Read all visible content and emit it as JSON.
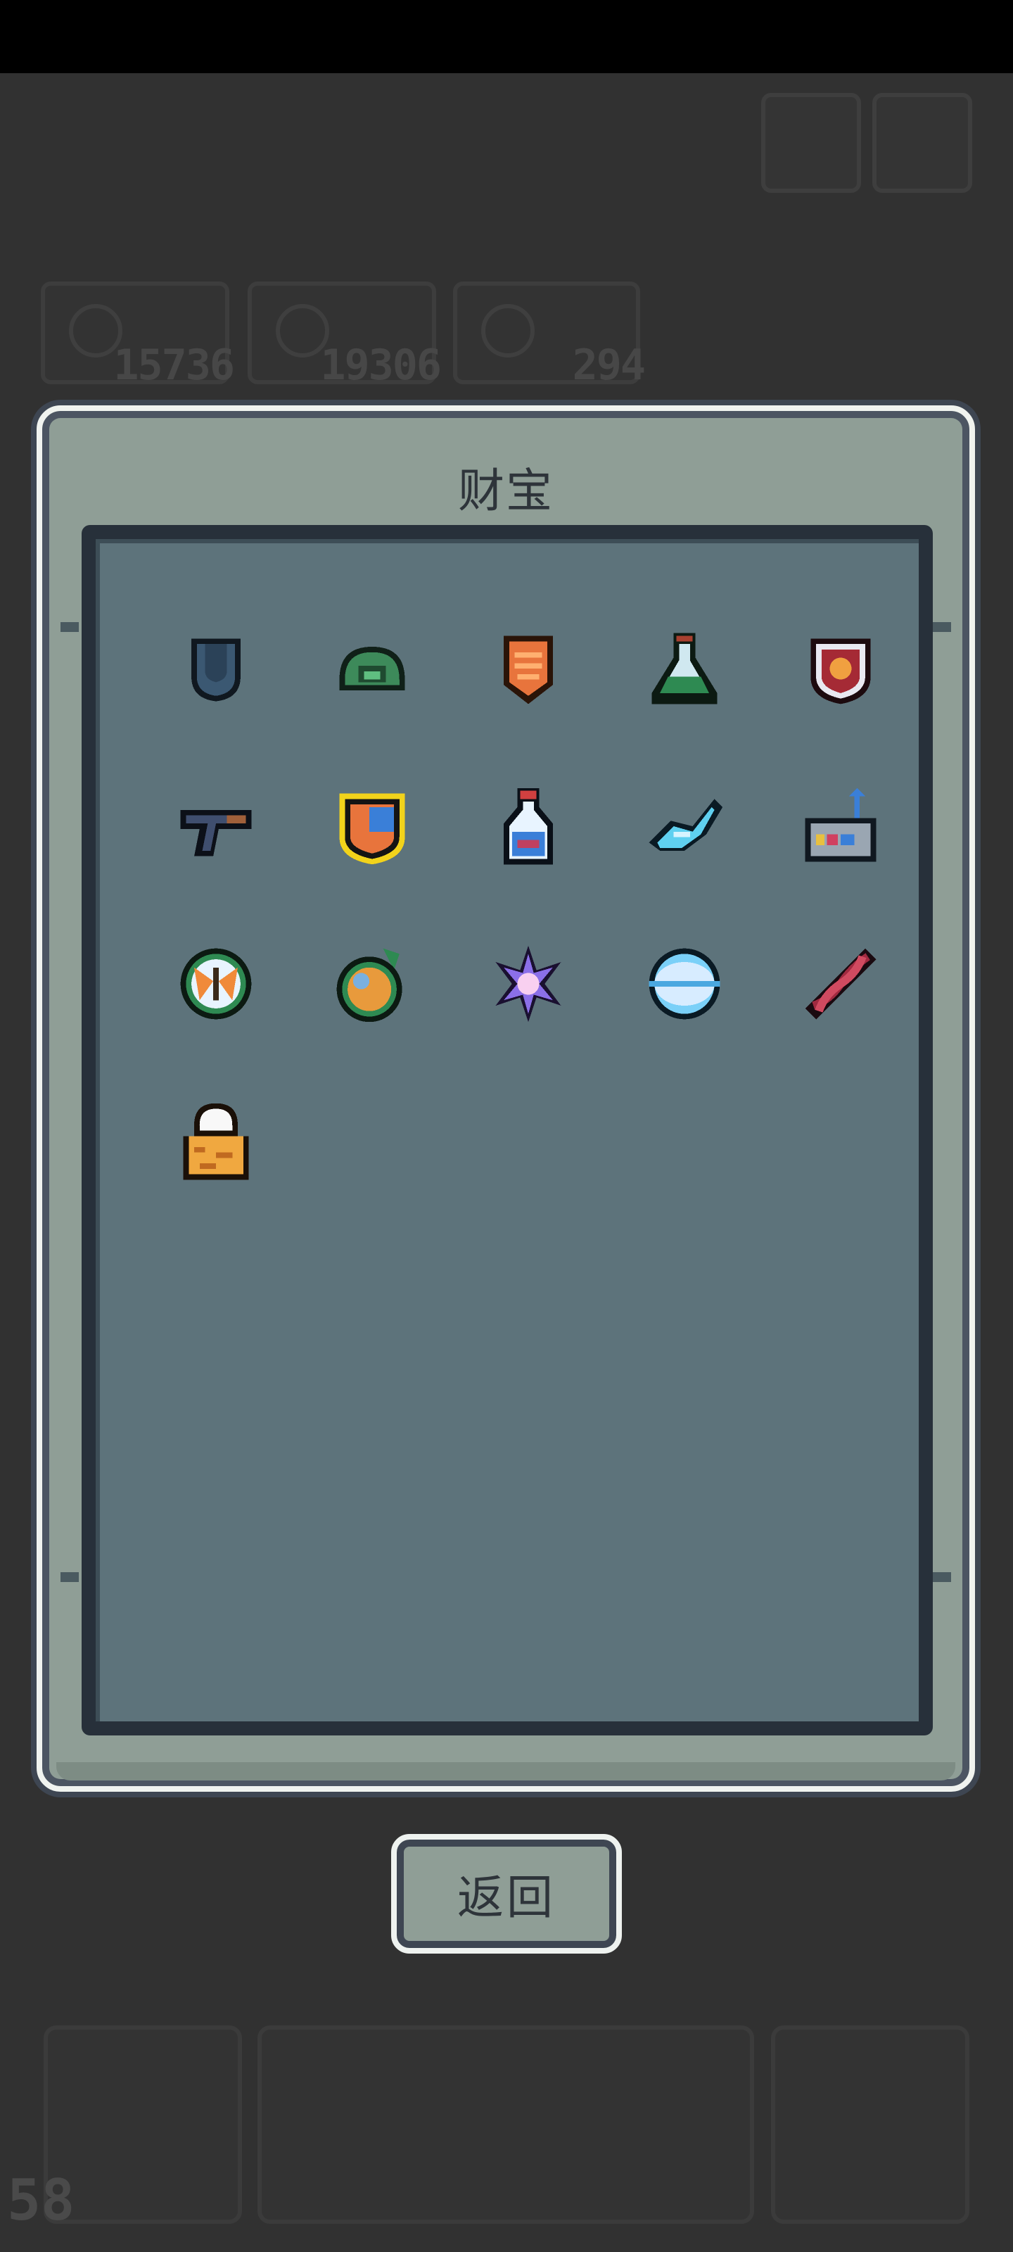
{
  "hud": {
    "stats": [
      {
        "name": "coins",
        "value": "15736"
      },
      {
        "name": "gems",
        "value": "19306"
      },
      {
        "name": "materials",
        "value": "294"
      }
    ],
    "level": "58"
  },
  "modal": {
    "title": "财宝",
    "treasures": [
      {
        "icon": "blue-shield-icon",
        "color": "#3b5872"
      },
      {
        "icon": "green-turtle-shell-icon",
        "color": "#3d8a5a"
      },
      {
        "icon": "orange-armor-icon",
        "color": "#e8743c"
      },
      {
        "icon": "green-potion-flask-icon",
        "color": "#2e8a52"
      },
      {
        "icon": "red-lion-crest-icon",
        "color": "#a52a35"
      },
      {
        "icon": "blue-pistol-gun-icon",
        "color": "#3f4e6e"
      },
      {
        "icon": "golden-flag-badge-icon",
        "color": "#f2d31b"
      },
      {
        "icon": "blue-bottle-icon",
        "color": "#3a7fd8"
      },
      {
        "icon": "ice-crystal-fish-icon",
        "color": "#5fd0f0"
      },
      {
        "icon": "toolbox-antenna-icon",
        "color": "#9aa6b2"
      },
      {
        "icon": "butterfly-orb-icon",
        "color": "#2e8a52"
      },
      {
        "icon": "orange-gem-orb-icon",
        "color": "#e89a3c"
      },
      {
        "icon": "purple-star-flower-icon",
        "color": "#8b6fe8"
      },
      {
        "icon": "white-planet-disc-icon",
        "color": "#d7ecff"
      },
      {
        "icon": "red-dna-helix-icon",
        "color": "#a02a40"
      },
      {
        "icon": "orange-striped-glove-icon",
        "color": "#f0a840"
      }
    ]
  },
  "buttons": {
    "back_label": "返回"
  }
}
